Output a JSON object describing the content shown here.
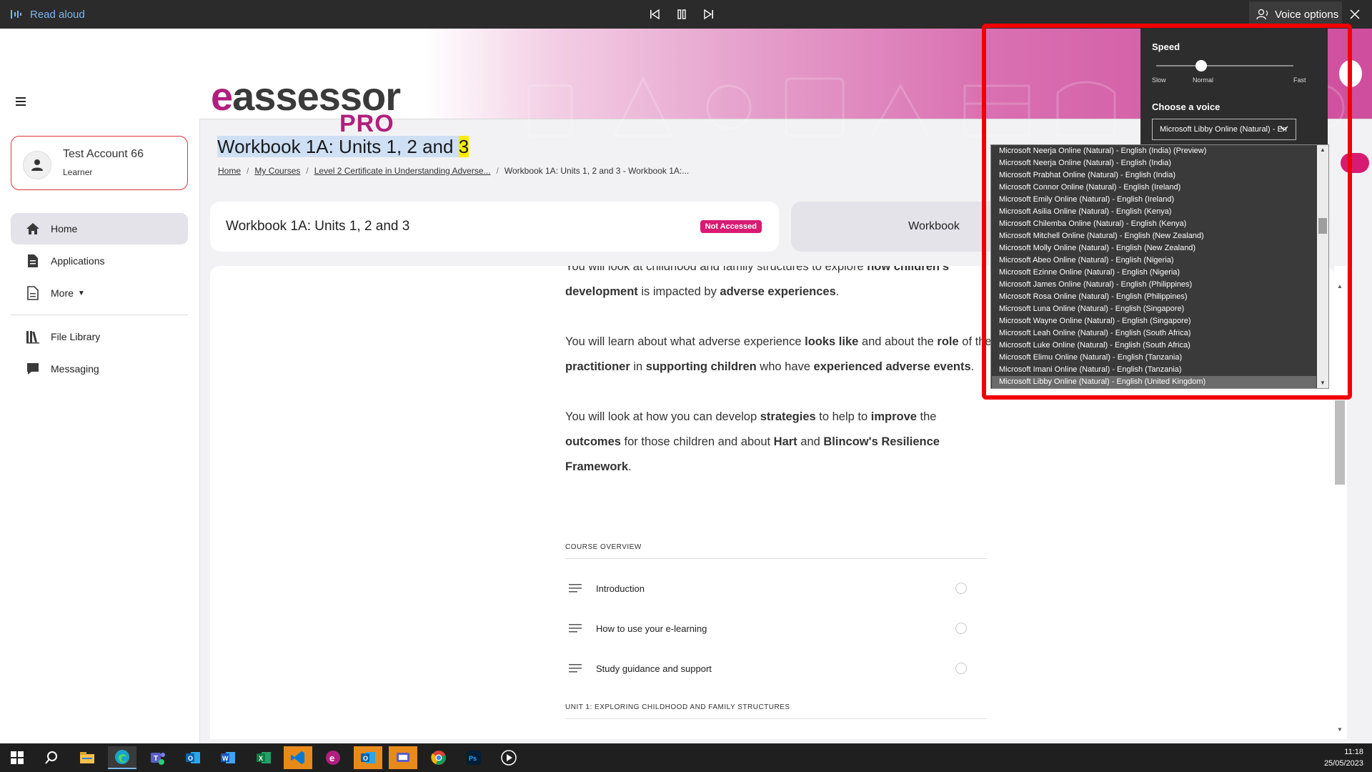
{
  "read_aloud": {
    "title": "Read aloud",
    "voice_options_label": "Voice options",
    "speed_label": "Speed",
    "speed_value": "Normal",
    "speed_fraction": 0.33,
    "speed_min": "Slow",
    "speed_mid": "Normal",
    "speed_max": "Fast",
    "choose_voice_label": "Choose a voice",
    "selected_voice": "Microsoft Libby Online (Natural) - En",
    "voices": [
      "Microsoft Neerja Online (Natural) - English (India) (Preview)",
      "Microsoft Neerja Online (Natural) - English (India)",
      "Microsoft Prabhat Online (Natural) - English (India)",
      "Microsoft Connor Online (Natural) - English (Ireland)",
      "Microsoft Emily Online (Natural) - English (Ireland)",
      "Microsoft Asilia Online (Natural) - English (Kenya)",
      "Microsoft Chilemba Online (Natural) - English (Kenya)",
      "Microsoft Mitchell Online (Natural) - English (New Zealand)",
      "Microsoft Molly Online (Natural) - English (New Zealand)",
      "Microsoft Abeo Online (Natural) - English (Nigeria)",
      "Microsoft Ezinne Online (Natural) - English (Nigeria)",
      "Microsoft James Online (Natural) - English (Philippines)",
      "Microsoft Rosa Online (Natural) - English (Philippines)",
      "Microsoft Luna Online (Natural) - English (Singapore)",
      "Microsoft Wayne Online (Natural) - English (Singapore)",
      "Microsoft Leah Online (Natural) - English (South Africa)",
      "Microsoft Luke Online (Natural) - English (South Africa)",
      "Microsoft Elimu Online (Natural) - English (Tanzania)",
      "Microsoft Imani Online (Natural) - English (Tanzania)",
      "Microsoft Libby Online (Natural) - English (United Kingdom)"
    ],
    "selected_index": 19
  },
  "logo": {
    "word": "assessor",
    "e": "e",
    "pro": "PRO"
  },
  "account": {
    "name": "Test Account 66",
    "role": "Learner"
  },
  "nav": {
    "home": "Home",
    "applications": "Applications",
    "more": "More",
    "file_library": "File Library",
    "messaging": "Messaging"
  },
  "page": {
    "title_main": "Workbook 1A: Units 1, 2 and ",
    "title_highlight": "3",
    "breadcrumb": {
      "home": "Home",
      "my_courses": "My Courses",
      "level": "Level 2 Certificate in Understanding Adverse...",
      "current": "Workbook 1A: Units 1, 2 and 3 - Workbook 1A:..."
    },
    "course_name": "Workbook 1A: Units 1, 2 and 3",
    "status_badge": "Not Accessed",
    "workbook_button": "Workbook"
  },
  "content": {
    "p0_a": "You will look at childhood and family structures to explore ",
    "p0_b": "how children's",
    "p0_c": "development",
    "p0_d": " is impacted by ",
    "p0_e": "adverse experiences",
    "p0_f": ".",
    "p1_a": "You will learn about what adverse experience ",
    "p1_b": "looks like",
    "p1_c": " and about the ",
    "p1_d": "role",
    "p1_e": " of the ",
    "p1_f": "practitioner",
    "p1_g": " in ",
    "p1_h": "supporting children",
    "p1_i": " who have ",
    "p1_j": "experienced adverse events",
    "p1_k": ".",
    "p2_a": "You will look at how you can develop ",
    "p2_b": "strategies",
    "p2_c": " to help to ",
    "p2_d": "improve",
    "p2_e": " the ",
    "p2_f": "outcomes",
    "p2_g": " for those children and about ",
    "p2_h": "Hart",
    "p2_i": " and ",
    "p2_j": "Blincow's Resilience Framework",
    "p2_k": ".",
    "course_overview": "COURSE OVERVIEW",
    "lessons": [
      "Introduction",
      "How to use your e-learning",
      "Study guidance and support"
    ],
    "unit1_heading": "UNIT 1: EXPLORING CHILDHOOD AND FAMILY STRUCTURES"
  },
  "taskbar": {
    "time": "11:18",
    "date": "25/05/2023"
  },
  "colors": {
    "brand_magenta": "#b01f7e",
    "badge": "#d81b72",
    "highlight_box": "#f00000"
  }
}
